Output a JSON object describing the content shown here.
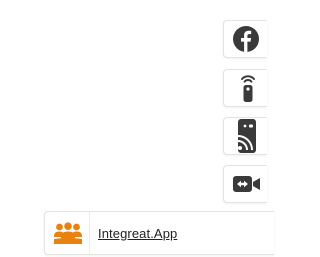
{
  "sidebar": {
    "items": [
      {
        "name": "facebook",
        "icon": "facebook-icon"
      },
      {
        "name": "remote",
        "icon": "remote-control-icon"
      },
      {
        "name": "cast",
        "icon": "cast-to-device-icon"
      },
      {
        "name": "video",
        "icon": "video-call-icon"
      }
    ]
  },
  "app_bar": {
    "icon": "people-group-icon",
    "link_label": "Integreat.App"
  },
  "colors": {
    "icon_dark": "#3a3a3a",
    "brand_orange": "#e8810e",
    "border": "#e3e3e3"
  }
}
